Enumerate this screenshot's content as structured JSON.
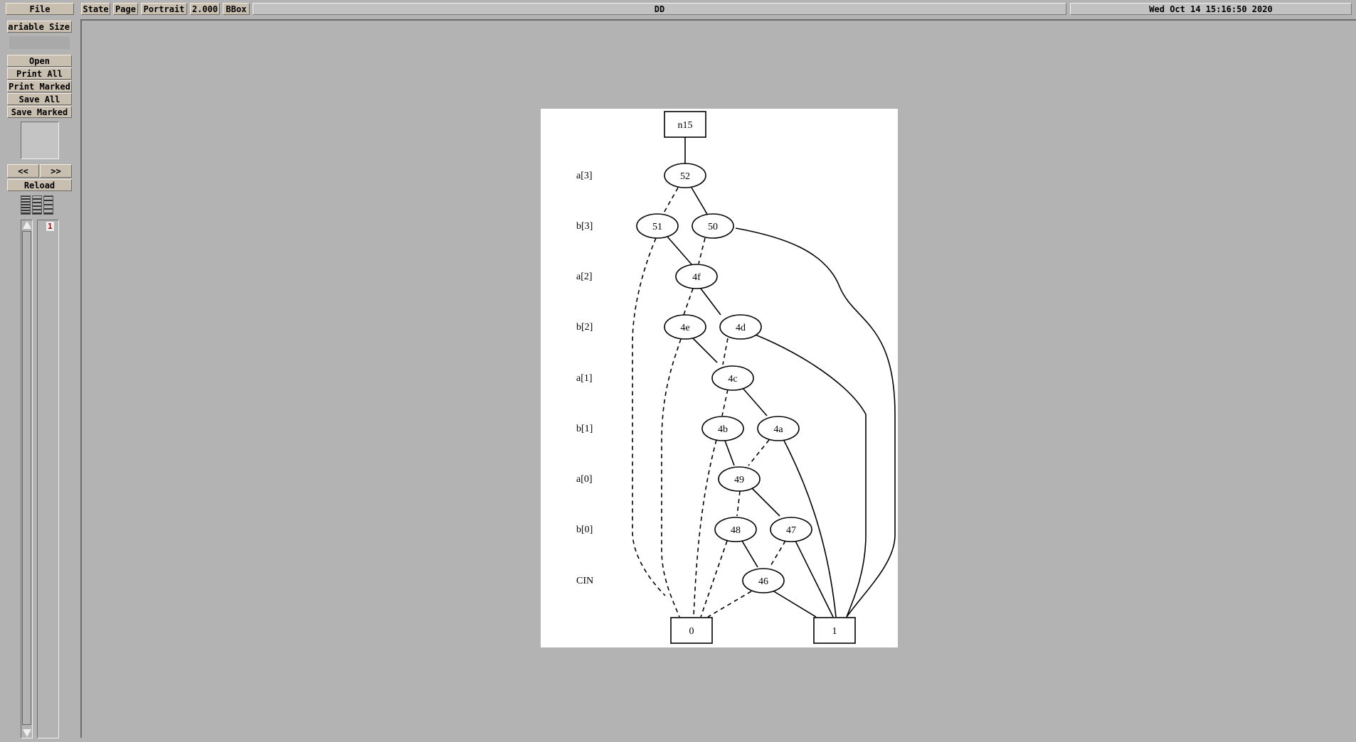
{
  "menubar": {
    "file": "File",
    "state": "State",
    "page": "Page",
    "orientation": "Portrait",
    "magnification": "2.000",
    "bbox": "BBox",
    "title": "DD",
    "date": "Wed Oct 14 15:16:50 2020"
  },
  "left_panel": {
    "size_label": "Variable Size",
    "open": "Open",
    "print_all": "Print All",
    "print_marked": "Print Marked",
    "save_all": "Save All",
    "save_marked": "Save Marked",
    "prev": "<<",
    "next": ">>",
    "reload": "Reload",
    "page_list": [
      "1"
    ]
  },
  "graph": {
    "root": "n15",
    "levels": [
      "a[3]",
      "b[3]",
      "a[2]",
      "b[2]",
      "a[1]",
      "b[1]",
      "a[0]",
      "b[0]",
      "CIN"
    ],
    "nodes": [
      "52",
      "51",
      "50",
      "4f",
      "4e",
      "4d",
      "4c",
      "4b",
      "4a",
      "49",
      "48",
      "47",
      "46"
    ],
    "terminals": [
      "0",
      "1"
    ]
  }
}
